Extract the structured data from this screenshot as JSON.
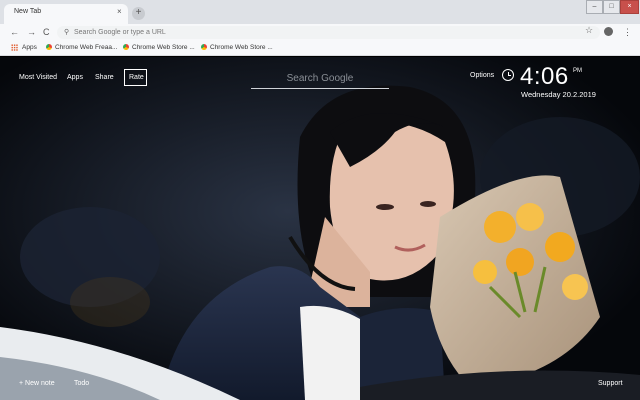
{
  "browser": {
    "tab_title": "New Tab",
    "tab_close_glyph": "×",
    "new_tab_glyph": "+",
    "window_controls": [
      "–",
      "□",
      "×"
    ],
    "nav": {
      "back": "←",
      "forward": "→",
      "reload": "C"
    },
    "omnibox_placeholder": "Search Google or type a URL",
    "bookmarks": [
      {
        "label": "Apps",
        "icon": "apps-grid-icon"
      },
      {
        "label": "Chrome Web Freaa...",
        "icon": "chrome-icon"
      },
      {
        "label": "Chrome Web Store ...",
        "icon": "chrome-icon"
      },
      {
        "label": "Chrome Web Store ...",
        "icon": "chrome-icon"
      }
    ]
  },
  "newtab": {
    "nav": [
      "Most Visited",
      "Apps",
      "Share",
      "Rate"
    ],
    "search_placeholder": "Search Google",
    "options_label": "Options",
    "time": "4:06",
    "time_suffix": "PM",
    "date": "Wednesday  20.2.2019",
    "footer": {
      "new_note": "+ New note",
      "todo": "Todo",
      "support": "Support"
    }
  },
  "colors": {
    "chrome_bg": "#dee1e6",
    "toolbar_bg": "#f7f8fa",
    "overlay_text": "#ffffff"
  }
}
